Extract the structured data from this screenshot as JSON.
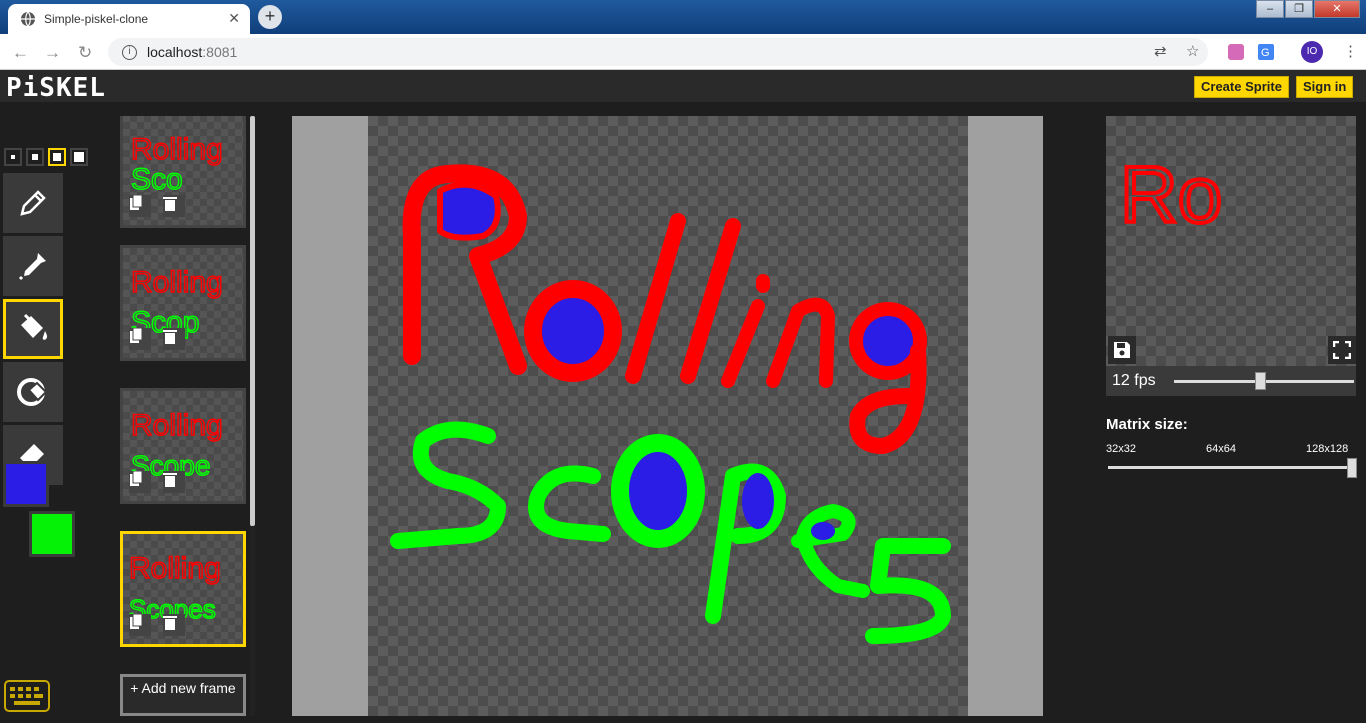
{
  "browser": {
    "tab_title": "Simple-piskel-clone",
    "tab_close": "✕",
    "new_tab": "+",
    "url_host": "localhost",
    "url_port": ":8081",
    "avatar_initials": "IO",
    "window_buttons": [
      "–",
      "❐",
      "✕"
    ]
  },
  "app": {
    "logo": "PiSKEL",
    "create_sprite": "Create Sprite",
    "sign_in": "Sign in"
  },
  "tools": {
    "pen_sizes": [
      "1",
      "2",
      "3",
      "4"
    ],
    "selected_pen_size": 3,
    "items": [
      "pen-tool",
      "color-picker-tool",
      "paint-bucket-tool",
      "paint-all-same-color-tool",
      "eraser-tool"
    ],
    "selected_tool": "paint-bucket-tool",
    "primary_color": "#2b1de6",
    "secondary_color": "#05f105"
  },
  "frames": {
    "items": [
      {
        "line1": "Rolling",
        "line2": "Sco"
      },
      {
        "line1": "Rolling",
        "line2": "Scop"
      },
      {
        "line1": "Rolling",
        "line2": "Scope"
      },
      {
        "line1": "Rolling",
        "line2": "Scopes"
      }
    ],
    "selected_index": 3,
    "add_frame_label": "+ Add new frame"
  },
  "canvas": {
    "red": "#ff0000",
    "green": "#00ff00",
    "blue": "#2b1de6"
  },
  "preview": {
    "fps_label": "12 fps",
    "fps_value": 12,
    "preview_text": "Ro"
  },
  "matrix": {
    "label": "Matrix size:",
    "options": [
      "32x32",
      "64x64",
      "128x128"
    ],
    "selected": "128x128"
  }
}
